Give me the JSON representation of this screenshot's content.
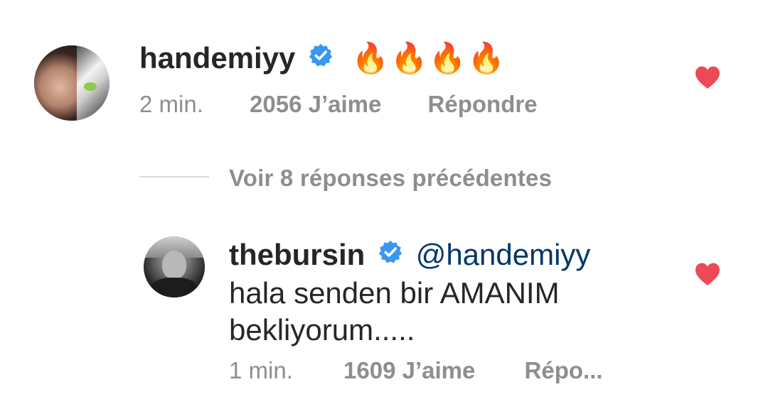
{
  "comments": [
    {
      "username": "handemiyy",
      "verified": true,
      "text": "🔥🔥🔥🔥",
      "time": "2 min.",
      "likes": "2056 J’aime",
      "reply": "Répondre",
      "liked": true
    }
  ],
  "view_replies": "Voir 8 réponses précédentes",
  "reply": {
    "username": "thebursin",
    "verified": true,
    "mention": "@handemiyy",
    "text_line1": "hala senden bir AMANIM",
    "text_line2": "bekliyorum.....",
    "time": "1 min.",
    "likes": "1609 J’aime",
    "reply": "Répo...",
    "liked": true
  },
  "colors": {
    "heart": "#ed4956",
    "verified": "#3897f0",
    "meta": "#8e8e8e",
    "mention": "#00376b"
  },
  "icons": {
    "verified": "verified-badge-icon",
    "heart": "heart-icon"
  }
}
